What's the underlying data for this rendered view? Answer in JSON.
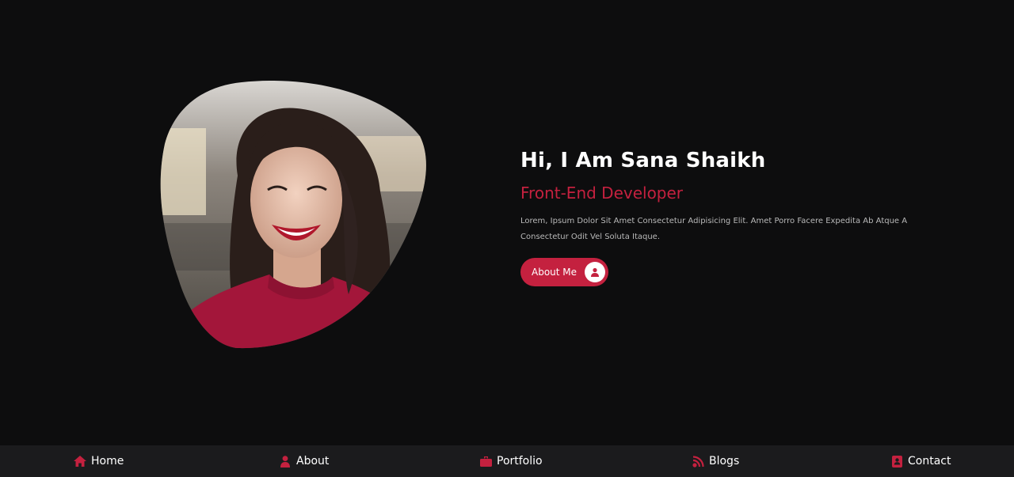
{
  "colors": {
    "accent": "#c4213f",
    "background": "#0d0d0e",
    "navbar_background": "#1b1b1d"
  },
  "hero": {
    "title": "Hi, I Am Sana Shaikh",
    "subtitle": "Front-End Developer",
    "description": "Lorem, Ipsum Dolor Sit Amet Consectetur Adipisicing Elit. Amet Porro Facere Expedita Ab Atque A Consectetur Odit Vel Soluta Itaque.",
    "button_label": "About Me",
    "button_icon": "user-icon"
  },
  "nav": {
    "items": [
      {
        "label": "Home",
        "icon": "home-icon"
      },
      {
        "label": "About",
        "icon": "user-icon"
      },
      {
        "label": "Portfolio",
        "icon": "briefcase-icon"
      },
      {
        "label": "Blogs",
        "icon": "blog-icon"
      },
      {
        "label": "Contact",
        "icon": "contact-icon"
      }
    ]
  }
}
